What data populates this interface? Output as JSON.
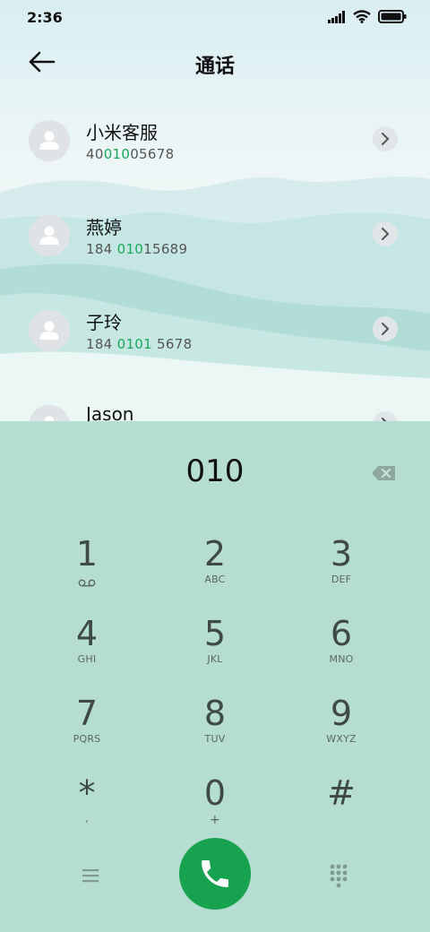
{
  "status": {
    "time": "2:36"
  },
  "header": {
    "title": "通话"
  },
  "contacts": [
    {
      "name": "小米客服",
      "number_pre": "40",
      "number_hl": "010",
      "number_post": "05678"
    },
    {
      "name": "燕婷",
      "number_pre": "184 ",
      "number_hl": "010",
      "number_post": "15689"
    },
    {
      "name": "子玲",
      "number_pre": "184 ",
      "number_hl": "0101",
      "number_post": " 5678"
    },
    {
      "name": "Jason",
      "number_pre": "",
      "number_hl": "",
      "number_post": ""
    }
  ],
  "dialer": {
    "input": "010",
    "keys": [
      {
        "digit": "1",
        "letters": ""
      },
      {
        "digit": "2",
        "letters": "ABC"
      },
      {
        "digit": "3",
        "letters": "DEF"
      },
      {
        "digit": "4",
        "letters": "GHI"
      },
      {
        "digit": "5",
        "letters": "JKL"
      },
      {
        "digit": "6",
        "letters": "MNO"
      },
      {
        "digit": "7",
        "letters": "PQRS"
      },
      {
        "digit": "8",
        "letters": "TUV"
      },
      {
        "digit": "9",
        "letters": "WXYZ"
      },
      {
        "digit": "*",
        "letters": ","
      },
      {
        "digit": "0",
        "letters": "+"
      },
      {
        "digit": "#",
        "letters": ""
      }
    ]
  },
  "colors": {
    "pad_bg": "#b6ddd1",
    "call_green": "#16a24f",
    "match_highlight": "#19a85b"
  },
  "icons": [
    "signal-icon",
    "wifi-icon",
    "battery-icon",
    "back-arrow-icon",
    "chevron-right-icon",
    "backspace-icon",
    "voicemail-icon",
    "menu-icon",
    "phone-icon",
    "dialpad-icon"
  ]
}
